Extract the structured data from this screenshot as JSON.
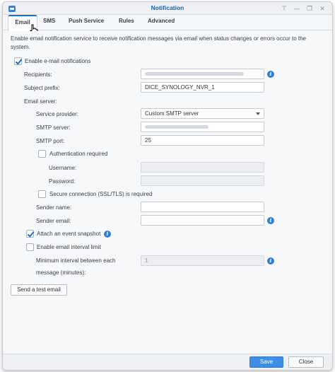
{
  "window": {
    "title": "Notification"
  },
  "tabs": [
    {
      "label": "Email"
    },
    {
      "label": "SMS"
    },
    {
      "label": "Push Service"
    },
    {
      "label": "Rules"
    },
    {
      "label": "Advanced"
    }
  ],
  "description": "Enable email notification service to receive notification messages via email when status changes or errors occur to the system.",
  "enable_email": {
    "label": "Enable e-mail notifications",
    "checked": true
  },
  "recipients": {
    "label": "Recipients:",
    "value": ""
  },
  "subject_prefix": {
    "label": "Subject prefix:",
    "value": "DICE_SYNOLOGY_NVR_1"
  },
  "email_server": {
    "label": "Email server:"
  },
  "service_provider": {
    "label": "Service provider:",
    "value": "Custom SMTP server"
  },
  "smtp_server": {
    "label": "SMTP server:",
    "value": ""
  },
  "smtp_port": {
    "label": "SMTP port:",
    "value": "25"
  },
  "auth_required": {
    "label": "Authentication required",
    "checked": false
  },
  "username": {
    "label": "Username:",
    "value": ""
  },
  "password": {
    "label": "Password:",
    "value": ""
  },
  "secure_connection": {
    "label": "Secure connection (SSL/TLS) is required",
    "checked": false
  },
  "sender_name": {
    "label": "Sender name:",
    "value": ""
  },
  "sender_email": {
    "label": "Sender email:",
    "value": ""
  },
  "attach_snapshot": {
    "label": "Attach an event snapshot",
    "checked": true
  },
  "interval_limit": {
    "label": "Enable email interval limit",
    "checked": false
  },
  "min_interval": {
    "label_line1": "Minimum interval between each",
    "label_line2": "message (minutes):",
    "value": "1"
  },
  "buttons": {
    "test_email": "Send a test email",
    "save": "Save",
    "close": "Close"
  },
  "icons": {
    "info": "i"
  },
  "colors": {
    "accent": "#1d6fce",
    "primary_button": "#3d8fe6"
  }
}
